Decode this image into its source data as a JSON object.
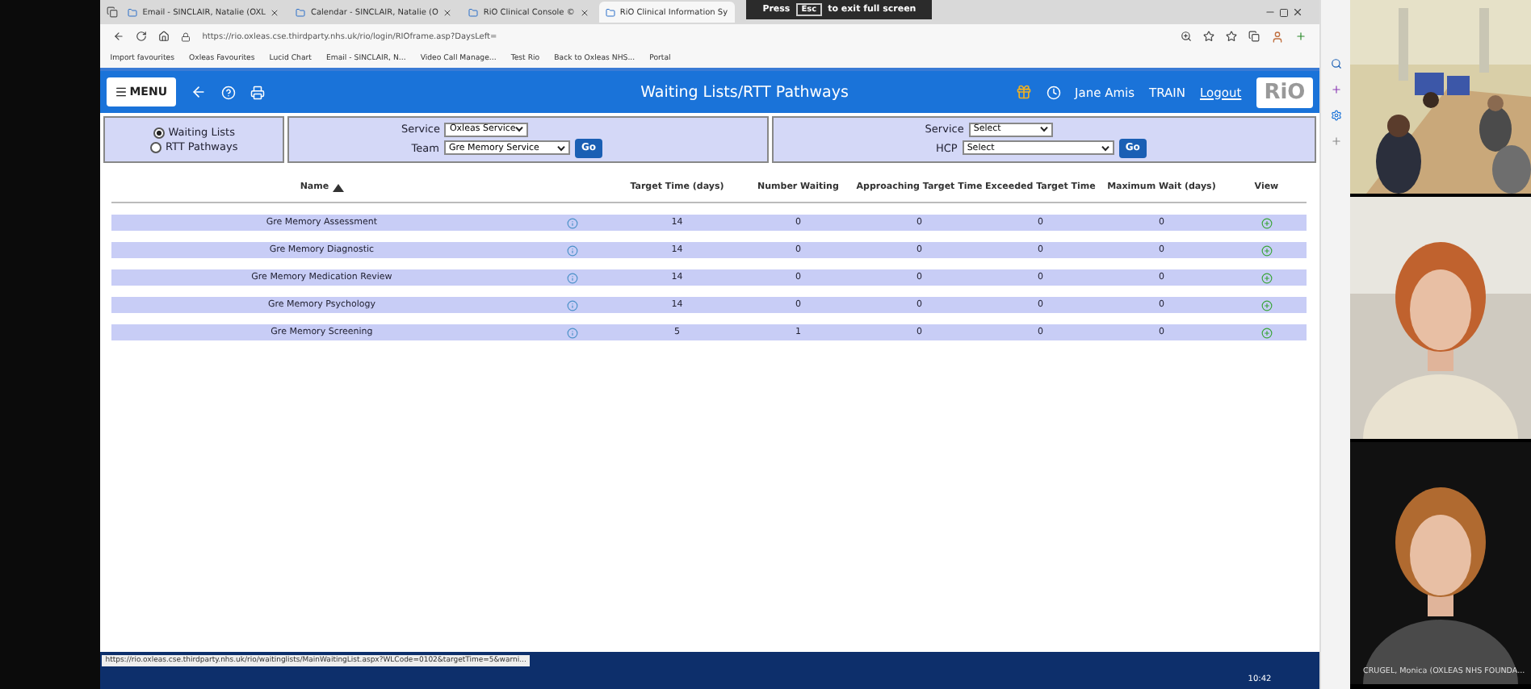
{
  "browser": {
    "tabs": [
      {
        "title": "Email - SINCLAIR, Natalie (OXL",
        "selected": false
      },
      {
        "title": "Calendar - SINCLAIR, Natalie (O",
        "selected": false
      },
      {
        "title": "RiO Clinical Console ©",
        "selected": false
      },
      {
        "title": "RiO Clinical Information Sy",
        "selected": true
      }
    ],
    "url": "https://rio.oxleas.cse.thirdparty.nhs.uk/rio/login/RIOframe.asp?DaysLeft=",
    "favourites": [
      "Import favourites",
      "Oxleas Favourites",
      "Lucid Chart",
      "Email - SINCLAIR, N...",
      "Video Call Manage...",
      "Test Rio",
      "Back to Oxleas NHS...",
      "Portal"
    ],
    "fullscreen_hint": {
      "press": "Press",
      "key": "Esc",
      "rest": "to exit full screen"
    },
    "status_url": "https://rio.oxleas.cse.thirdparty.nhs.uk/rio/waitinglists/MainWaitingList.aspx?WLCode=0102&targetTime=5&warni..."
  },
  "app": {
    "menu": "MENU",
    "title": "Waiting Lists/RTT Pathways",
    "user": "Jane Amis",
    "environment": "TRAIN",
    "logout": "Logout",
    "logo": "RiO",
    "modes": [
      {
        "label": "Waiting Lists",
        "selected": true
      },
      {
        "label": "RTT Pathways",
        "selected": false
      }
    ],
    "filters_left": {
      "service_label": "Service",
      "service": "Oxleas Service",
      "team_label": "Team",
      "team": "Gre Memory Service",
      "go": "Go"
    },
    "filters_right": {
      "service_label": "Service",
      "service": "Select",
      "hcp_label": "HCP",
      "hcp": "Select",
      "go": "Go"
    },
    "table": {
      "columns": [
        "Name",
        "",
        "Target Time (days)",
        "Number Waiting",
        "Approaching Target Time",
        "Exceeded Target Time",
        "Maximum Wait (days)",
        "View"
      ],
      "rows": [
        [
          "Gre Memory Assessment",
          "",
          "14",
          "0",
          "0",
          "0",
          "0"
        ],
        [
          "Gre Memory Diagnostic",
          "",
          "14",
          "0",
          "0",
          "0",
          "0"
        ],
        [
          "Gre Memory Medication Review",
          "",
          "14",
          "0",
          "0",
          "0",
          "0"
        ],
        [
          "Gre Memory Psychology",
          "",
          "14",
          "0",
          "0",
          "0",
          "0"
        ],
        [
          "Gre Memory Screening",
          "",
          "5",
          "1",
          "0",
          "0",
          "0"
        ]
      ]
    }
  },
  "taskbar": {
    "clock": "10:42"
  },
  "participants": [
    {
      "kind": "room"
    },
    {
      "kind": "person"
    },
    {
      "kind": "person",
      "name": "CRUGEL, Monica (OXLEAS NHS FOUNDA..."
    }
  ]
}
